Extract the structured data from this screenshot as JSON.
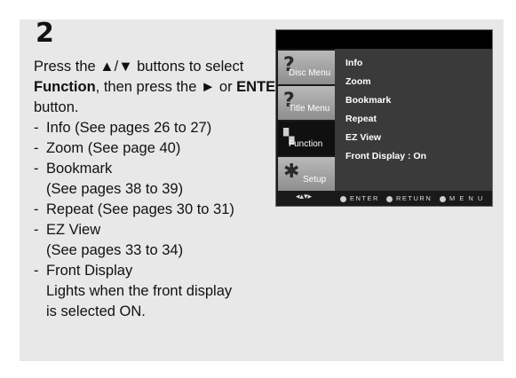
{
  "step": "2",
  "instruction": {
    "p1": "Press the ",
    "arrows": "▲/▼",
    "p2": " buttons to select ",
    "function_word": "Function",
    "p3": ", then press the ",
    "right_arrow": "►",
    "p4": " or ",
    "enter_word": "ENTER",
    "p5": " button."
  },
  "items": [
    {
      "dash": "-",
      "line1": "Info (See pages 26 to 27)"
    },
    {
      "dash": "-",
      "line1": "Zoom (See page 40)"
    },
    {
      "dash": "-",
      "line1": "Bookmark",
      "line2": "(See pages 38 to 39)"
    },
    {
      "dash": "-",
      "line1": "Repeat (See pages 30 to 31)"
    },
    {
      "dash": "-",
      "line1": "EZ View",
      "line2": "(See pages 33 to 34)"
    },
    {
      "dash": "-",
      "line1": "Front Display",
      "line2": "Lights when the front display",
      "line3": "is selected ON."
    }
  ],
  "osd": {
    "tabs": [
      {
        "label": "Disc Menu",
        "icon": "disc-question-icon"
      },
      {
        "label": "Title Menu",
        "icon": "title-question-icon"
      },
      {
        "label": "Function",
        "icon": "function-grid-icon"
      },
      {
        "label": "Setup",
        "icon": "setup-gear-icon"
      }
    ],
    "menu_items": [
      "Info",
      "Zoom",
      "Bookmark",
      "Repeat",
      "EZ View",
      "Front Display : On"
    ],
    "bottom": {
      "enter": "ENTER",
      "return": "RETURN",
      "menu": "M E N U"
    }
  }
}
